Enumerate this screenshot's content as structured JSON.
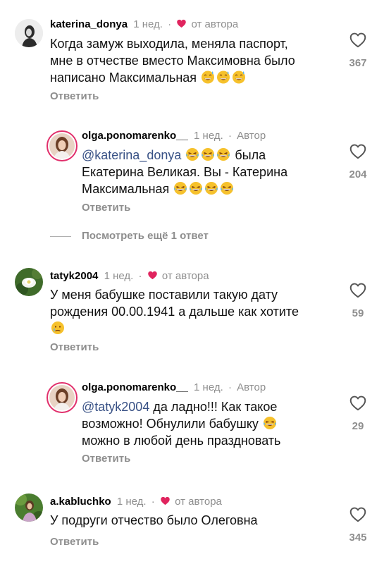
{
  "comments": [
    {
      "username": "katerina_donya",
      "time": "1 нед.",
      "author_label": "от автора",
      "text": "Когда замуж выходила, меняла паспорт, мне в отчестве вместо Максимовна было написано Максимальная",
      "likes": "367",
      "reply": "Ответить"
    },
    {
      "username": "olga.ponomarenko__",
      "time": "1 нед.",
      "author_label": "Автор",
      "mention": "@katerina_donya",
      "text": "была Екатерина Великая. Вы - Катерина Максимальная",
      "likes": "204",
      "reply": "Ответить"
    },
    {
      "username": "tatyk2004",
      "time": "1 нед.",
      "author_label": "от автора",
      "text": "У меня бабушке поставили такую дату рождения 00.00.1941 а дальше как хотите",
      "likes": "59",
      "reply": "Ответить"
    },
    {
      "username": "olga.ponomarenko__",
      "time": "1 нед.",
      "author_label": "Автор",
      "mention": "@tatyk2004",
      "text": "да ладно!!! Как такое возможно! Обнулили бабушку можно в любой день праздновать",
      "likes": "29",
      "reply": "Ответить"
    },
    {
      "username": "a.kabluchko",
      "time": "1 нед.",
      "author_label": "от автора",
      "text": "У подруги отчество было Олеговна",
      "likes": "345",
      "reply": "Ответить"
    }
  ],
  "more_replies": "Посмотреть ещё 1 ответ",
  "dot": "·",
  "text_lines": {
    "c1": [
      "Когда замуж выходила, меняла паспорт,",
      "мне в отчестве вместо Максимовна было",
      "написано Максимальная"
    ],
    "c2_line1_rest": "была",
    "c2_line2": "Екатерина Великая. Вы - Катерина",
    "c2_line3": "Максимальная",
    "c3": [
      "У меня бабушке поставили такую дату",
      "рождения 00.00.1941 а дальше как хотите"
    ],
    "c4_line1_rest": "да ладно!!! Как такое",
    "c4_line2": "возможно! Обнулили бабушку",
    "c4_line3": "можно в любой день праздновать",
    "c5": [
      "У подруги отчество было Олеговна"
    ]
  },
  "colors": {
    "heart": "#e0245e",
    "muted": "#8e8e8e",
    "mention": "#385185"
  }
}
